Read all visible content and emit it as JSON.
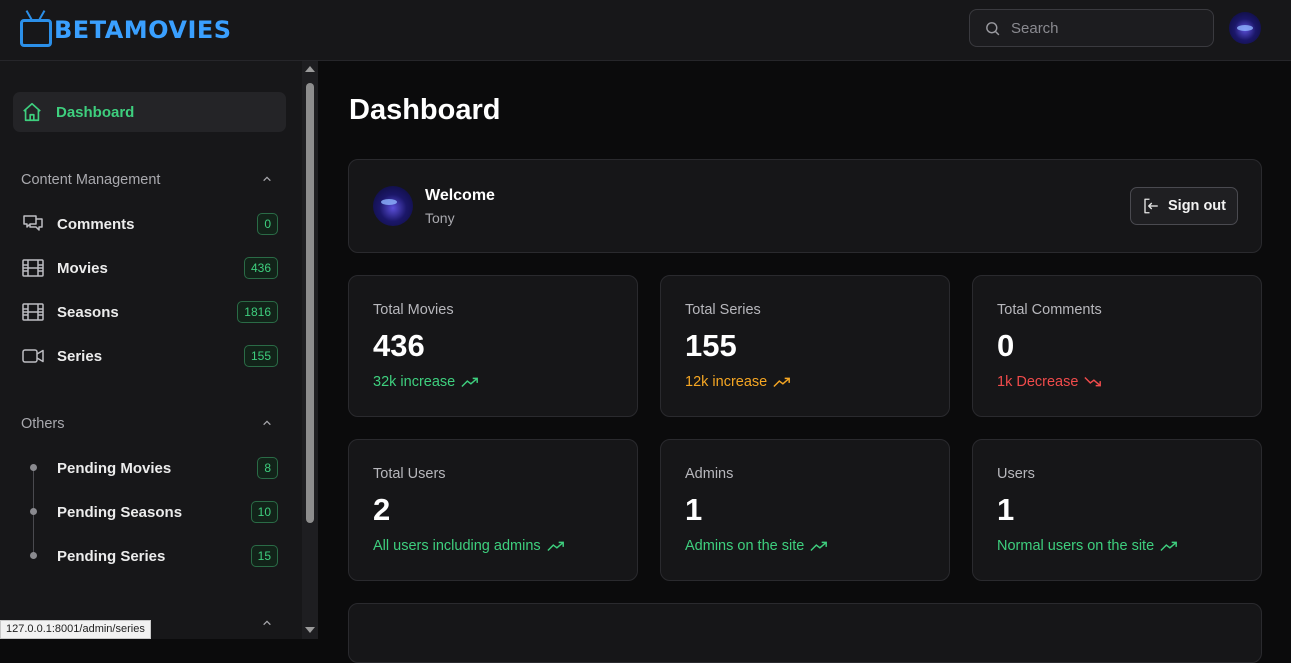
{
  "header": {
    "logo_text": "BETAMOVIES",
    "search_placeholder": "Search"
  },
  "sidebar": {
    "active_item": {
      "label": "Dashboard",
      "icon": "home-icon"
    },
    "sections": [
      {
        "title": "Content Management",
        "items": [
          {
            "label": "Comments",
            "count": "0",
            "icon": "comments-icon"
          },
          {
            "label": "Movies",
            "count": "436",
            "icon": "film-icon"
          },
          {
            "label": "Seasons",
            "count": "1816",
            "icon": "film-icon"
          },
          {
            "label": "Series",
            "count": "155",
            "icon": "video-camera-icon"
          }
        ]
      },
      {
        "title": "Others",
        "items": [
          {
            "label": "Pending Movies",
            "count": "8"
          },
          {
            "label": "Pending Seasons",
            "count": "10"
          },
          {
            "label": "Pending Series",
            "count": "15"
          }
        ]
      }
    ]
  },
  "status_url": "127.0.0.1:8001/admin/series",
  "main": {
    "title": "Dashboard",
    "welcome": {
      "title": "Welcome",
      "name": "Tony",
      "sign_out_label": "Sign out"
    },
    "stats": [
      {
        "label": "Total Movies",
        "value": "436",
        "note": "32k increase",
        "trend": "up",
        "color": "#3ecf7e"
      },
      {
        "label": "Total Series",
        "value": "155",
        "note": "12k increase",
        "trend": "up",
        "color": "#f5a623"
      },
      {
        "label": "Total Comments",
        "value": "0",
        "note": "1k Decrease",
        "trend": "down",
        "color": "#f04b4b"
      },
      {
        "label": "Total Users",
        "value": "2",
        "note": "All users including admins",
        "trend": "up",
        "color": "#3ecf7e"
      },
      {
        "label": "Admins",
        "value": "1",
        "note": "Admins on the site",
        "trend": "up",
        "color": "#3ecf7e"
      },
      {
        "label": "Users",
        "value": "1",
        "note": "Normal users on the site",
        "trend": "up",
        "color": "#3ecf7e"
      }
    ]
  }
}
